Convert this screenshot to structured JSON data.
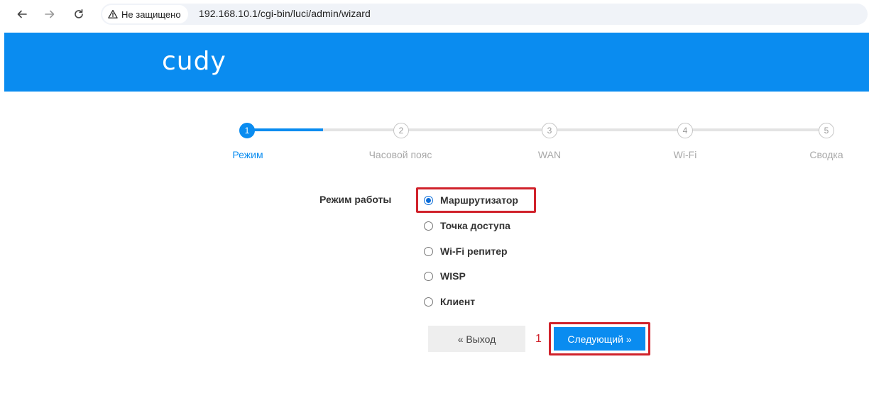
{
  "browser": {
    "back_icon": "arrow-left-icon",
    "forward_icon": "arrow-right-icon",
    "reload_icon": "reload-icon",
    "security_icon": "warning-triangle-icon",
    "security_text": "Не защищено",
    "url": "192.168.10.1/cgi-bin/luci/admin/wizard"
  },
  "header": {
    "logo": "cudy",
    "bg_color": "#0a8cf0"
  },
  "stepper": {
    "current_step": 1,
    "steps": [
      {
        "number": "1",
        "label": "Режим"
      },
      {
        "number": "2",
        "label": "Часовой пояс"
      },
      {
        "number": "3",
        "label": "WAN"
      },
      {
        "number": "4",
        "label": "Wi-Fi"
      },
      {
        "number": "5",
        "label": "Сводка"
      }
    ]
  },
  "form": {
    "mode_label": "Режим работы",
    "options": [
      {
        "label": "Маршрутизатор",
        "checked": true
      },
      {
        "label": "Точка доступа",
        "checked": false
      },
      {
        "label": "Wi-Fi репитер",
        "checked": false
      },
      {
        "label": "WISP",
        "checked": false
      },
      {
        "label": "Клиент",
        "checked": false
      }
    ]
  },
  "actions": {
    "exit_label": "« Выход",
    "next_label": "Следующий »",
    "annotation_number": "1",
    "highlight_color": "#d0222b"
  }
}
